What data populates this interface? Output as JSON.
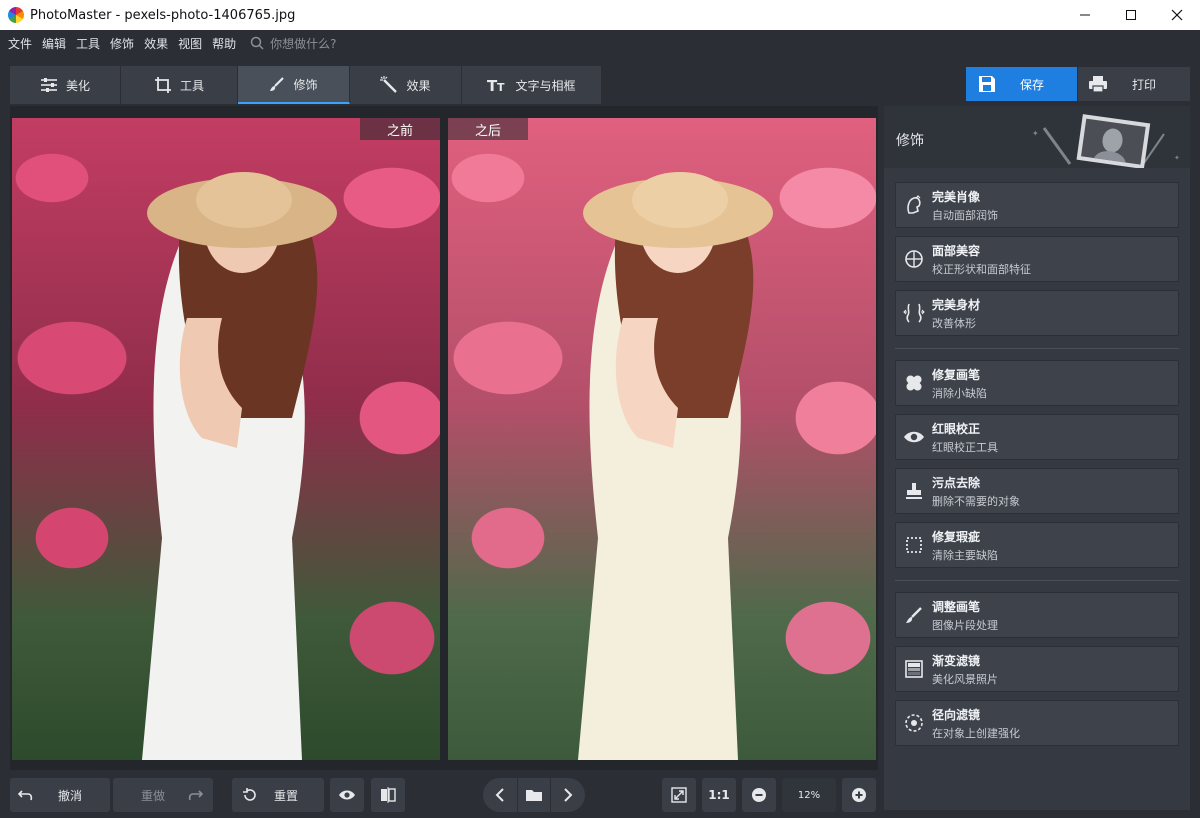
{
  "window": {
    "title": "PhotoMaster - pexels-photo-1406765.jpg",
    "controls": [
      "minimize-icon",
      "maximize-icon",
      "close-icon"
    ]
  },
  "menu": {
    "items": [
      "文件",
      "编辑",
      "工具",
      "修饰",
      "效果",
      "视图",
      "帮助"
    ],
    "search_placeholder": "你想做什么?"
  },
  "tabs": [
    {
      "label": "美化",
      "icon": "sliders-icon"
    },
    {
      "label": "工具",
      "icon": "crop-icon"
    },
    {
      "label": "修饰",
      "icon": "brush-icon",
      "active": true
    },
    {
      "label": "效果",
      "icon": "magic-wand-icon"
    },
    {
      "label": "文字与相框",
      "icon": "text-icon"
    }
  ],
  "actions": {
    "save_label": "保存",
    "print_label": "打印"
  },
  "viewer": {
    "before_label": "之前",
    "after_label": "之后"
  },
  "bottom": {
    "undo_label": "撤消",
    "redo_label": "重做",
    "reset_label": "重置",
    "ratio_label": "1:1",
    "zoom_value": "12%"
  },
  "panel": {
    "title": "修饰",
    "groups": [
      [
        {
          "title": "完美肖像",
          "desc": "自动面部润饰",
          "icon": "portrait-icon"
        },
        {
          "title": "面部美容",
          "desc": "校正形状和面部特征",
          "icon": "face-target-icon"
        },
        {
          "title": "完美身材",
          "desc": "改善体形",
          "icon": "body-icon"
        }
      ],
      [
        {
          "title": "修复画笔",
          "desc": "消除小缺陷",
          "icon": "bandage-icon"
        },
        {
          "title": "红眼校正",
          "desc": "红眼校正工具",
          "icon": "eye-icon"
        },
        {
          "title": "污点去除",
          "desc": "删除不需要的对象",
          "icon": "stamp-icon"
        },
        {
          "title": "修复瑕疵",
          "desc": "清除主要缺陷",
          "icon": "patch-icon"
        }
      ],
      [
        {
          "title": "调整画笔",
          "desc": "图像片段处理",
          "icon": "adjust-brush-icon"
        },
        {
          "title": "渐变滤镜",
          "desc": "美化风景照片",
          "icon": "gradient-filter-icon"
        },
        {
          "title": "径向滤镜",
          "desc": "在对象上创建强化",
          "icon": "radial-filter-icon"
        }
      ]
    ]
  },
  "colors": {
    "accent": "#1f7fe0",
    "tab_active_underline": "#3aa3ff",
    "panel_bg": "#353a42",
    "toolbar_bg": "#2b2f35"
  }
}
